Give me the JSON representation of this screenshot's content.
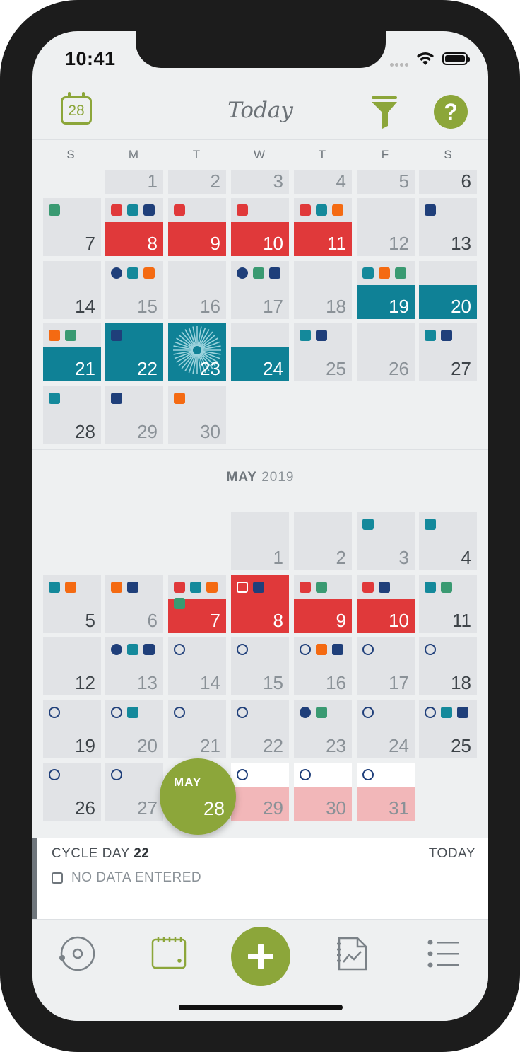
{
  "status_bar": {
    "time": "10:41"
  },
  "header": {
    "calendar_button_day": "28",
    "title": "Today",
    "help_label": "?"
  },
  "weekdays": [
    "S",
    "M",
    "T",
    "W",
    "T",
    "F",
    "S"
  ],
  "colors": {
    "period_red": "#e0393a",
    "fertile_teal": "#0f8196",
    "predicted_pink": "#f2b7b9",
    "accent_green": "#8ca63a",
    "marker_navy": "#1f3f7a",
    "marker_orange": "#f46a12",
    "marker_green": "#3a9a72",
    "marker_teal": "#14899b"
  },
  "april_days": [
    {
      "day": "1",
      "markers": []
    },
    {
      "day": "2",
      "markers": []
    },
    {
      "day": "3",
      "markers": []
    },
    {
      "day": "4",
      "markers": []
    },
    {
      "day": "5",
      "markers": []
    },
    {
      "day": "6",
      "markers": []
    },
    {
      "day": "7",
      "markers": [
        "green-square"
      ]
    },
    {
      "day": "8",
      "markers": [
        "red-square",
        "teal-square",
        "navy-square"
      ],
      "state": "period"
    },
    {
      "day": "9",
      "markers": [
        "red-square"
      ],
      "state": "period"
    },
    {
      "day": "10",
      "markers": [
        "red-square"
      ],
      "state": "period"
    },
    {
      "day": "11",
      "markers": [
        "red-square",
        "teal-square",
        "orange-square"
      ],
      "state": "period"
    },
    {
      "day": "12",
      "markers": []
    },
    {
      "day": "13",
      "markers": [
        "navy-square"
      ]
    },
    {
      "day": "14",
      "markers": []
    },
    {
      "day": "15",
      "markers": [
        "navy-dot",
        "teal-square",
        "orange-square"
      ]
    },
    {
      "day": "16",
      "markers": []
    },
    {
      "day": "17",
      "markers": [
        "navy-dot",
        "green-square",
        "navy-square"
      ]
    },
    {
      "day": "18",
      "markers": []
    },
    {
      "day": "19",
      "markers": [
        "teal-square",
        "orange-square",
        "green-square"
      ],
      "state": "fertile"
    },
    {
      "day": "20",
      "markers": [],
      "state": "fertile"
    },
    {
      "day": "21",
      "markers": [
        "orange-square",
        "green-square"
      ],
      "state": "fertile"
    },
    {
      "day": "22",
      "markers": [
        "navy-square"
      ],
      "state": "fertile-full"
    },
    {
      "day": "23",
      "markers": [],
      "state": "ovulation"
    },
    {
      "day": "24",
      "markers": [],
      "state": "fertile"
    },
    {
      "day": "25",
      "markers": [
        "teal-square",
        "navy-square"
      ]
    },
    {
      "day": "26",
      "markers": []
    },
    {
      "day": "27",
      "markers": [
        "teal-square",
        "navy-square"
      ]
    },
    {
      "day": "28",
      "markers": [
        "teal-square"
      ]
    },
    {
      "day": "29",
      "markers": [
        "navy-square"
      ]
    },
    {
      "day": "30",
      "markers": [
        "orange-square"
      ]
    }
  ],
  "may_header": {
    "month": "MAY",
    "year": "2019"
  },
  "may_days": [
    {
      "day": "1",
      "markers": []
    },
    {
      "day": "2",
      "markers": []
    },
    {
      "day": "3",
      "markers": [
        "teal-square"
      ]
    },
    {
      "day": "4",
      "markers": [
        "teal-square"
      ]
    },
    {
      "day": "5",
      "markers": [
        "teal-square",
        "orange-square"
      ]
    },
    {
      "day": "6",
      "markers": [
        "orange-square",
        "navy-square"
      ]
    },
    {
      "day": "7",
      "markers": [
        "red-square",
        "teal-square",
        "orange-square",
        "green-square"
      ],
      "state": "period"
    },
    {
      "day": "8",
      "markers": [
        "white-square-outline",
        "navy-square"
      ],
      "state": "period-full"
    },
    {
      "day": "9",
      "markers": [
        "red-square",
        "green-square"
      ],
      "state": "period"
    },
    {
      "day": "10",
      "markers": [
        "red-square",
        "navy-square"
      ],
      "state": "period"
    },
    {
      "day": "11",
      "markers": [
        "teal-square",
        "green-square"
      ]
    },
    {
      "day": "12",
      "markers": []
    },
    {
      "day": "13",
      "markers": [
        "navy-dot",
        "teal-square",
        "navy-square"
      ]
    },
    {
      "day": "14",
      "markers": [
        "ring"
      ]
    },
    {
      "day": "15",
      "markers": [
        "ring"
      ]
    },
    {
      "day": "16",
      "markers": [
        "ring",
        "orange-square",
        "navy-square"
      ]
    },
    {
      "day": "17",
      "markers": [
        "ring"
      ]
    },
    {
      "day": "18",
      "markers": [
        "ring"
      ]
    },
    {
      "day": "19",
      "markers": [
        "ring"
      ]
    },
    {
      "day": "20",
      "markers": [
        "ring",
        "teal-square"
      ]
    },
    {
      "day": "21",
      "markers": [
        "ring"
      ]
    },
    {
      "day": "22",
      "markers": [
        "ring"
      ]
    },
    {
      "day": "23",
      "markers": [
        "navy-dot",
        "green-square"
      ]
    },
    {
      "day": "24",
      "markers": [
        "ring"
      ]
    },
    {
      "day": "25",
      "markers": [
        "ring",
        "teal-square",
        "navy-square"
      ]
    },
    {
      "day": "26",
      "markers": [
        "ring"
      ]
    },
    {
      "day": "27",
      "markers": [
        "ring"
      ]
    },
    {
      "day": "28",
      "markers": [],
      "state": "today"
    },
    {
      "day": "29",
      "markers": [
        "ring"
      ],
      "state": "predicted"
    },
    {
      "day": "30",
      "markers": [
        "ring"
      ],
      "state": "predicted"
    },
    {
      "day": "31",
      "markers": [
        "ring"
      ],
      "state": "predicted"
    }
  ],
  "today_bubble": {
    "month": "MAY",
    "day": "28"
  },
  "cycle_panel": {
    "cycle_label": "CYCLE DAY",
    "cycle_day": "22",
    "today_label": "TODAY",
    "no_data_label": "NO DATA ENTERED"
  },
  "tabbar": {
    "tabs": [
      "cycle-tab-icon",
      "calendar-tab-icon",
      "add-entry-icon",
      "charts-tab-icon",
      "list-tab-icon"
    ]
  }
}
